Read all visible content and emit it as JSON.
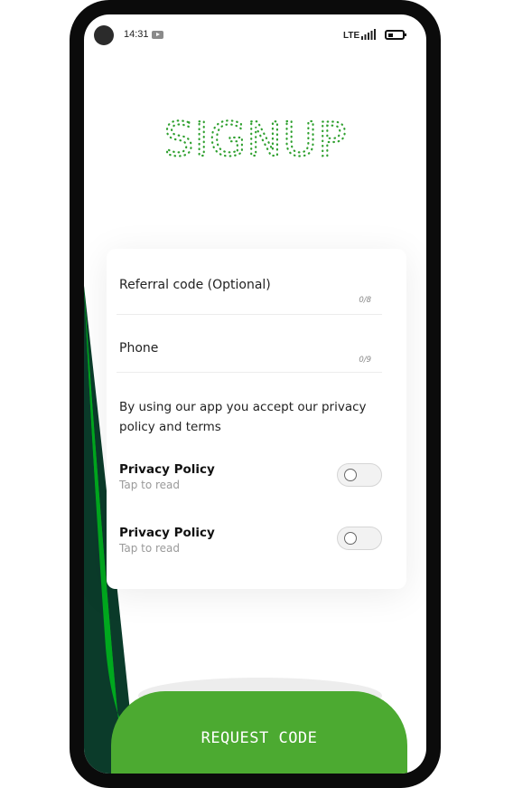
{
  "status_bar": {
    "time": "14:31",
    "network": "LTE",
    "icons": [
      "youtube-icon",
      "signal-icon",
      "battery-icon"
    ]
  },
  "header": {
    "title": "SIGNUP"
  },
  "form": {
    "referral": {
      "label": "Referral code (Optional)",
      "counter": "0/8"
    },
    "phone": {
      "label": "Phone",
      "counter": "0/9"
    },
    "terms_text": "By using our app you accept our privacy policy and terms",
    "toggles": [
      {
        "title": "Privacy Policy",
        "subtitle": "Tap to read",
        "checked": false
      },
      {
        "title": "Privacy Policy",
        "subtitle": "Tap to read",
        "checked": false
      }
    ]
  },
  "actions": {
    "request_code_label": "REQUEST CODE"
  },
  "colors": {
    "brand_green": "#4caa31",
    "bright_green": "#00a81e",
    "dark_green": "#0b3b2a",
    "title_green": "#2fa02f"
  }
}
